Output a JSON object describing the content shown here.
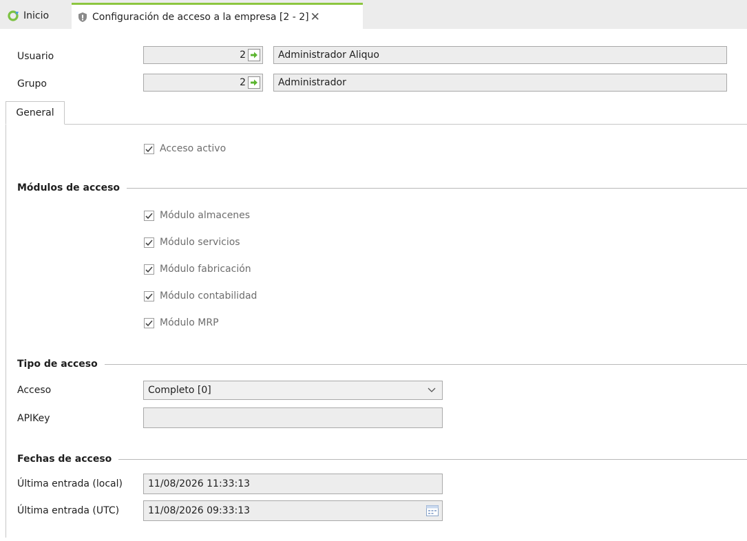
{
  "tabs": {
    "home_label": "Inicio",
    "active_label": "Configuración de acceso a la empresa [2 - 2]",
    "close_glyph": "✕"
  },
  "header": {
    "usuario_label": "Usuario",
    "usuario_code": "2",
    "usuario_name": "Administrador Aliquo",
    "grupo_label": "Grupo",
    "grupo_code": "2",
    "grupo_name": "Administrador"
  },
  "content_tab": {
    "label": "General"
  },
  "acceso_activo": {
    "label": "Acceso activo",
    "checked": true
  },
  "modulos": {
    "title": "Módulos de acceso",
    "items": [
      {
        "label": "Módulo almacenes",
        "checked": true
      },
      {
        "label": "Módulo servicios",
        "checked": true
      },
      {
        "label": "Módulo fabricación",
        "checked": true
      },
      {
        "label": "Módulo contabilidad",
        "checked": true
      },
      {
        "label": "Módulo MRP",
        "checked": true
      }
    ]
  },
  "tipo_acceso": {
    "title": "Tipo de acceso",
    "acceso_label": "Acceso",
    "acceso_value": "Completo [0]",
    "apikey_label": "APIKey",
    "apikey_value": ""
  },
  "fechas": {
    "title": "Fechas de acceso",
    "local_label": "Última entrada (local)",
    "local_value": "11/08/2026 11:33:13",
    "utc_label": "Última entrada (UTC)",
    "utc_value": "11/08/2026 09:33:13"
  },
  "colors": {
    "accent_green": "#8cc63f",
    "field_bg": "#ededed",
    "disabled_text": "#6d6d6d"
  }
}
